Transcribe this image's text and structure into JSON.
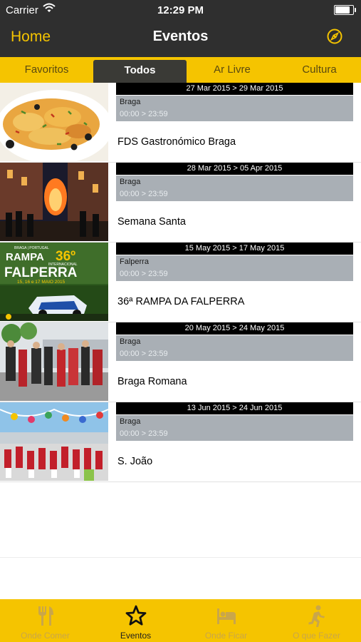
{
  "status_bar": {
    "carrier": "Carrier",
    "time": "12:29 PM",
    "battery_level": 0.9
  },
  "nav": {
    "back_label": "Home",
    "title": "Eventos",
    "action_icon": "compass-icon"
  },
  "tabs": [
    {
      "label": "Favoritos",
      "active": false
    },
    {
      "label": "Todos",
      "active": true
    },
    {
      "label": "Ar Livre",
      "active": false
    },
    {
      "label": "Cultura",
      "active": false
    }
  ],
  "events": [
    {
      "dates": "27 Mar 2015 > 29 Mar 2015",
      "location": "Braga",
      "hours": "00:00 > 23:59",
      "title": "FDS Gastronómico Braga"
    },
    {
      "dates": "28 Mar 2015 > 05 Apr 2015",
      "location": "Braga",
      "hours": "00:00 > 23:59",
      "title": "Semana Santa"
    },
    {
      "dates": "15 May 2015 > 17 May 2015",
      "location": "Falperra",
      "hours": "00:00 > 23:59",
      "title": "36ª RAMPA DA FALPERRA",
      "poster": {
        "top": "BRAGA | PORTUGAL",
        "rampa": "RAMPA",
        "num": "36º",
        "sub": "INTERNACIONAL",
        "name": "FALPERRA",
        "dates": "15, 16 e 17 MAIO 2015"
      }
    },
    {
      "dates": "20 May 2015 > 24 May 2015",
      "location": "Braga",
      "hours": "00:00 > 23:59",
      "title": "Braga Romana"
    },
    {
      "dates": "13 Jun 2015 > 24 Jun 2015",
      "location": "Braga",
      "hours": "00:00 > 23:59",
      "title": "S. João"
    }
  ],
  "tabbar": [
    {
      "label": "Onde Comer",
      "icon": "fork-knife-icon",
      "active": false
    },
    {
      "label": "Eventos",
      "icon": "star-icon",
      "active": true
    },
    {
      "label": "Onde Ficar",
      "icon": "bed-icon",
      "active": false
    },
    {
      "label": "O que Fazer",
      "icon": "running-person-icon",
      "active": false
    }
  ],
  "colors": {
    "accent": "#f5c400",
    "nav_bg": "#2f2f2f",
    "info_bg": "#a9afb5"
  }
}
